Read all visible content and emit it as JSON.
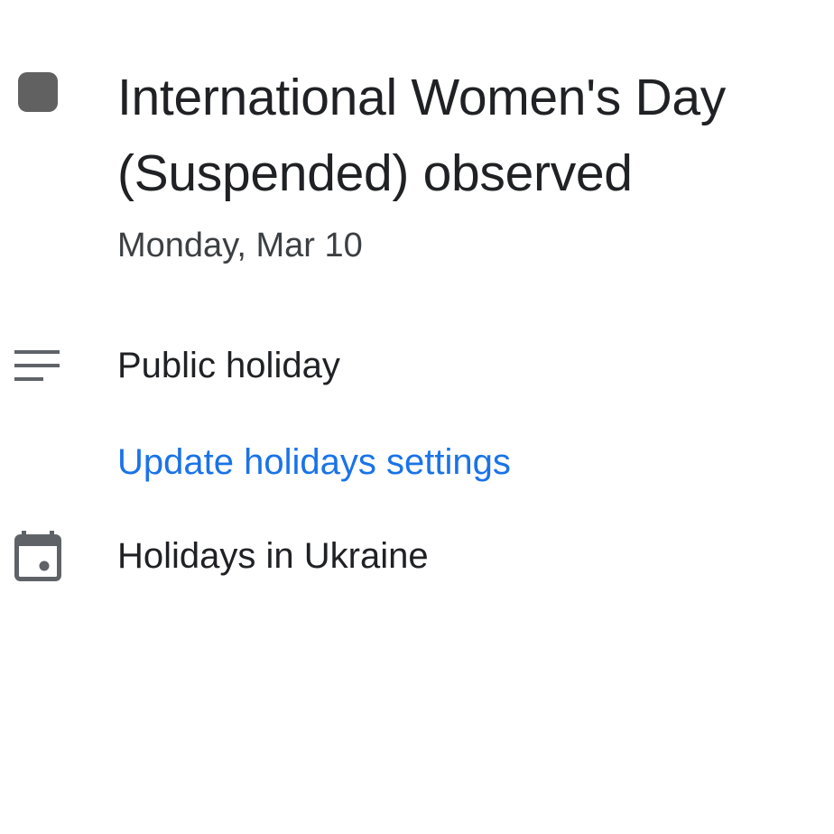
{
  "event": {
    "color": "#616161",
    "title": "International Women's Day\n(Suspended) observed",
    "date": "Monday, Mar 10"
  },
  "description": {
    "icon": "notes-icon",
    "text": "Public holiday",
    "link_label": "Update holidays settings",
    "link_color": "#1a73e8"
  },
  "calendar": {
    "icon": "calendar-icon",
    "name": "Holidays in Ukraine"
  }
}
